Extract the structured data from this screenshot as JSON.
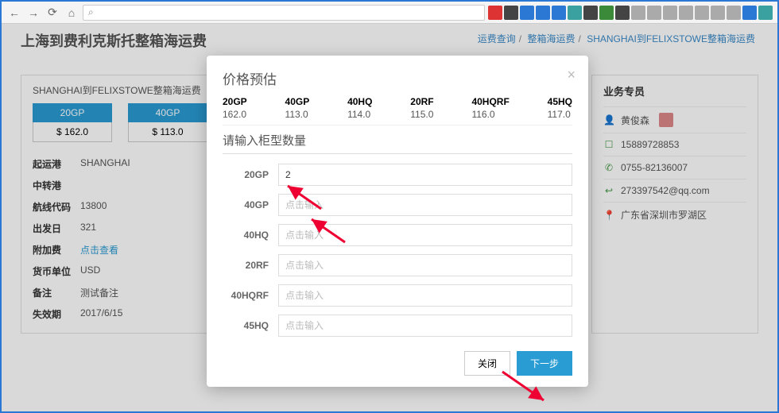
{
  "browser": {
    "url_placeholder": ""
  },
  "page": {
    "title": "上海到费利克斯托整箱海运费",
    "breadcrumb": {
      "a": "运费查询",
      "b": "整箱海运费",
      "c": "SHANGHAI到FELIXSTOWE整箱海运费"
    },
    "card_label": "SHANGHAI到FELIXSTOWE整箱海运费",
    "prices": [
      {
        "type": "20GP",
        "val": "$ 162.0"
      },
      {
        "type": "40GP",
        "val": "$ 113.0"
      }
    ],
    "details": {
      "origin_k": "起运港",
      "origin_v": "SHANGHAI",
      "transit_k": "中转港",
      "transit_v": "",
      "route_k": "航线代码",
      "route_v": "13800",
      "depart_k": "出发日",
      "depart_v": "321",
      "surcharge_k": "附加费",
      "surcharge_v": "点击查看",
      "currency_k": "货币单位",
      "currency_v": "USD",
      "remark_k": "备注",
      "remark_v": "测试备注",
      "expire_k": "失效期",
      "expire_v": "2017/6/15"
    }
  },
  "sidebar": {
    "title": "业务专员",
    "name": "黄俊森",
    "mobile": "15889728853",
    "tel": "0755-82136007",
    "email": "273397542@qq.com",
    "addr": "广东省深圳市罗湖区"
  },
  "modal": {
    "title": "价格预估",
    "columns": [
      {
        "h": "20GP",
        "v": "162.0"
      },
      {
        "h": "40GP",
        "v": "113.0"
      },
      {
        "h": "40HQ",
        "v": "114.0"
      },
      {
        "h": "20RF",
        "v": "115.0"
      },
      {
        "h": "40HQRF",
        "v": "116.0"
      },
      {
        "h": "45HQ",
        "v": "117.0"
      }
    ],
    "form_title": "请输入柜型数量",
    "fields": [
      {
        "label": "20GP",
        "value": "2",
        "placeholder": ""
      },
      {
        "label": "40GP",
        "value": "",
        "placeholder": "点击输入"
      },
      {
        "label": "40HQ",
        "value": "",
        "placeholder": "点击输入"
      },
      {
        "label": "20RF",
        "value": "",
        "placeholder": "点击输入"
      },
      {
        "label": "40HQRF",
        "value": "",
        "placeholder": "点击输入"
      },
      {
        "label": "45HQ",
        "value": "",
        "placeholder": "点击输入"
      }
    ],
    "close_label": "关闭",
    "next_label": "下一步"
  },
  "icons": {
    "back": "←",
    "forward": "→",
    "reload": "⟳",
    "home": "⌂",
    "search": "⌕",
    "user": "👤",
    "mobile": "☐",
    "phone": "✆",
    "reply": "↩",
    "pin": "📍"
  }
}
